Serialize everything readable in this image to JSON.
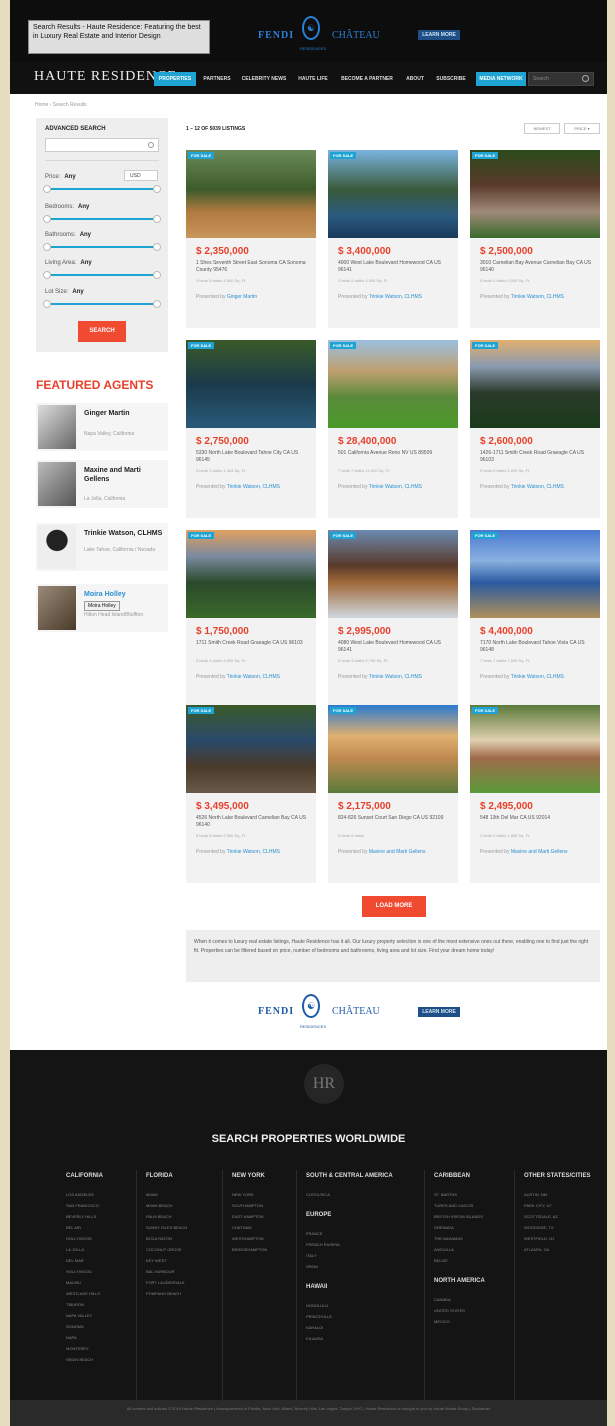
{
  "tooltip": "Search Results - Haute Residence: Featuring the best in Luxury Real Estate and Interior Design",
  "ad": {
    "brand": "FENDI",
    "seal": "☯",
    "partner": "CHÂTEAU",
    "cta": "LEARN MORE",
    "sub": "RESIDENCES"
  },
  "nav": {
    "logo": "HAUTE RESIDENCE",
    "items": [
      "PROPERTIES",
      "PARTNERS",
      "CELEBRITY NEWS",
      "HAUTE LIFE",
      "BECOME A PARTNER",
      "ABOUT",
      "SUBSCRIBE",
      "MEDIA NETWORK"
    ],
    "search_placeholder": "Search"
  },
  "breadcrumb": "Home › Search Results",
  "advanced_search": {
    "title": "ADVANCED SEARCH",
    "currency": "USD",
    "filters": [
      {
        "label": "Price:",
        "value": "Any"
      },
      {
        "label": "Bedrooms:",
        "value": "Any"
      },
      {
        "label": "Bathrooms:",
        "value": "Any"
      },
      {
        "label": "Living Area:",
        "value": "Any"
      },
      {
        "label": "Lot Size:",
        "value": "Any"
      }
    ],
    "button": "SEARCH"
  },
  "featured": {
    "title": "FEATURED AGENTS",
    "agents": [
      {
        "name": "Ginger Martin",
        "location": "Napa Valley, California"
      },
      {
        "name": "Maxine and Marti Gellens",
        "location": "La Jolla, California"
      },
      {
        "name": "Trinkie Watson, CLHMS",
        "location": "Lake Tahoe, California / Nevada"
      },
      {
        "name": "Moira Holley",
        "location": "Hilton Head Island/Bluffton"
      }
    ],
    "hover_tooltip": "Moira Holley"
  },
  "listings": {
    "count": "1 – 12 OF 5039 LISTINGS",
    "sort": [
      "NEWEST",
      "PRICE ▾"
    ],
    "tag": "FOR SALE",
    "cards": [
      {
        "price": "$ 2,350,000",
        "address": "1 Shes Seventh Street East Sonoma CA Sonoma County 95476",
        "details": "4 beds 5 baths 4,500 Sq. Ft.",
        "by": "Ginger Martin"
      },
      {
        "price": "$ 3,400,000",
        "address": "4000 West Lake Boulevard Homewood CA US 96141",
        "details": "4 beds 5 baths 4,500 Sq. Ft.",
        "by": "Trinkie Watson, CLHMS"
      },
      {
        "price": "$ 2,500,000",
        "address": "3010 Carnelian Bay Avenue Carnelian Bay CA US 96140",
        "details": "5 beds 5 baths 5,000 Sq. Ft.",
        "by": "Trinkie Watson, CLHMS"
      },
      {
        "price": "$ 2,750,000",
        "address": "5330 North Lake Boulevard Tahoe City CA US 96145",
        "details": "3 beds 2 baths 1,364 Sq. Ft.",
        "by": "Trinkie Watson, CLHMS"
      },
      {
        "price": "$ 28,400,000",
        "address": "501 California Avenue Reno NV US 89509",
        "details": "7 beds 7 baths 11,000 Sq. Ft.",
        "by": "Trinkie Watson, CLHMS"
      },
      {
        "price": "$ 2,600,000",
        "address": "1426-1711 Smith Creek Road Graeagle CA US 96103",
        "details": "5 beds 6 baths 5,000 Sq. Ft.",
        "by": "Trinkie Watson, CLHMS"
      },
      {
        "price": "$ 1,750,000",
        "address": "1711 Smith Creek Road Graeagle CA US 96103",
        "details": "3 beds 4 baths 4,000 Sq. Ft.",
        "by": "Trinkie Watson, CLHMS"
      },
      {
        "price": "$ 2,995,000",
        "address": "4080 West Lake Boulevard Homewood CA US 96141",
        "details": "5 beds 4 baths 5,740 Sq. Ft.",
        "by": "Trinkie Watson, CLHMS"
      },
      {
        "price": "$ 4,400,000",
        "address": "7170 North Lake Boulevard Tahoe Vista CA US 96148",
        "details": "7 beds 7 baths 7,000 Sq. Ft.",
        "by": "Trinkie Watson, CLHMS"
      },
      {
        "price": "$ 3,495,000",
        "address": "4526 North Lake Boulevard Carnelian Bay CA US 96140",
        "details": "5 beds 6 baths 2,550 Sq. Ft.",
        "by": "Trinkie Watson, CLHMS"
      },
      {
        "price": "$ 2,175,000",
        "address": "824-826 Sunset Court San Diego CA US 92109",
        "details": "5 beds 5 baths",
        "by": "Maxine and Marti Gellens"
      },
      {
        "price": "$ 2,495,000",
        "address": "548 13th Del Mar CA US 92014",
        "details": "3 beds 2 baths 1,838 Sq. Ft.",
        "by": "Maxine and Marti Gellens"
      }
    ],
    "load_more": "LOAD MORE"
  },
  "description": "When it comes to luxury real estate listings, Haute Residence has it all. Our luxury property selection is one of the most extensive ones out there, enabling one to find just the right fit. Properties can be filtered based on price, number of bedrooms and bathrooms, living area and lot size. Find your dream home today!",
  "footer": {
    "logo": "HR",
    "title": "SEARCH PROPERTIES WORLDWIDE",
    "columns": [
      {
        "heading": "CALIFORNIA",
        "links": [
          "LOS ANGELES",
          "SAN FRANCISCO",
          "BEVERLY HILLS",
          "BEL AIR",
          "HOLLYWOOD",
          "LA JOLLA",
          "DEL MAR",
          "HOLLYWOOD",
          "MALIBU",
          "WESTLAKE HILLS",
          "TIBURON",
          "NAPA VALLEY",
          "SONOMA",
          "NAPA",
          "MONTEREY",
          "SEDIN BEACH"
        ]
      },
      {
        "heading": "FLORIDA",
        "links": [
          "MIAMI",
          "MIAMI BEACH",
          "PALM BEACH",
          "SUNNY ISLES BEACH",
          "BOCA RATON",
          "COCONUT GROVE",
          "KEY WEST",
          "BAL HARBOUR",
          "FORT LAUDERDALE",
          "POMPANO BEACH"
        ]
      },
      {
        "heading": "NEW YORK",
        "links": [
          "NEW YORK",
          "SOUTHAMPTON",
          "EAST HAMPTON",
          "CHATHAM",
          "WESTHAMPTON",
          "BRIDGEHAMPTON"
        ]
      },
      {
        "heading": "SOUTH & CENTRAL AMERICA",
        "links": [
          "COSTA RICA"
        ],
        "heading2": "EUROPE",
        "links2": [
          "FRANCE",
          "FRENCH RIVIERA",
          "ITALY",
          "SPAIN"
        ],
        "heading3": "HAWAII",
        "links3": [
          "HONOLULU",
          "PRINCEVILLE",
          "KAHALOI",
          "KILAUEA"
        ]
      },
      {
        "heading": "CARIBBEAN",
        "links": [
          "ST. BARTHS",
          "TURKS AND CAICOS",
          "BRITISH VIRGIN ISLANDS",
          "GRENADA",
          "THE BAHAMAS",
          "ANGUILLA",
          "BELIZE"
        ],
        "heading2": "NORTH AMERICA",
        "links2": [
          "CANADA",
          "UNITED STATES",
          "MEXICO"
        ]
      },
      {
        "heading": "OTHER STATES/CITIES",
        "links": [
          "AUSTIN, NM",
          "PARK CITY, UT",
          "SCOTTSDALE, AZ",
          "WOODSIDE, TX",
          "WESTFIELD, NJ",
          "ATLANTA, GA"
        ]
      }
    ]
  },
  "copyright": "All content and articles © 2015 Haute Residence | Headquartered in Florida, New York, Miami, Beverly Hills, Las Vegas, Tampa, NYC | Haute Residence is brought to you by Haute Media Group | Disclaimer"
}
